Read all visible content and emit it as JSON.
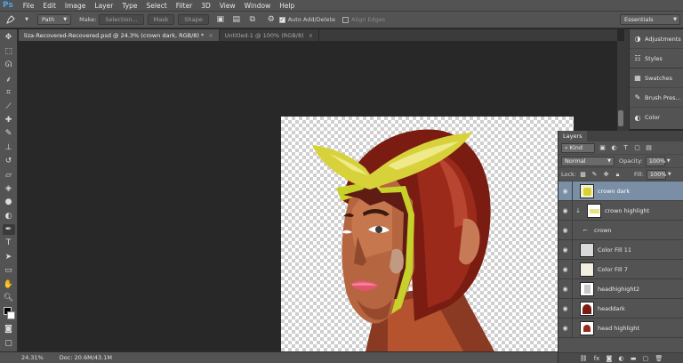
{
  "app": {
    "logo": "Ps",
    "menu": [
      "File",
      "Edit",
      "Image",
      "Layer",
      "Type",
      "Select",
      "Filter",
      "3D",
      "View",
      "Window",
      "Help"
    ]
  },
  "options": {
    "tool_icon": "pen-icon",
    "mode_value": "Path",
    "make_label": "Make:",
    "selection_btn": "Selection...",
    "mask_btn": "Mask",
    "shape_btn": "Shape",
    "auto_add_delete": "Auto Add/Delete",
    "align_edges": "Align Edges",
    "auto_add_checked": true,
    "align_edges_checked": false
  },
  "workspace": {
    "selected": "Essentials"
  },
  "tabs": [
    {
      "label": "liza-Recovered-Recovered.psd @ 24.3% (crown dark, RGB/8) *",
      "close": "×"
    },
    {
      "label": "Untitled-1 @ 100% (RGB/8)",
      "close": "×"
    }
  ],
  "status": {
    "zoom": "24.31%",
    "doc": "Doc: 20.6M/43.1M"
  },
  "right_panels": [
    {
      "label": "Adjustments",
      "icon": "adjustments-icon"
    },
    {
      "label": "Styles",
      "icon": "styles-icon"
    },
    {
      "label": "Swatches",
      "icon": "swatches-icon"
    },
    {
      "label": "Brush Pres...",
      "icon": "brush-presets-icon"
    },
    {
      "label": "Color",
      "icon": "color-icon"
    }
  ],
  "layers": {
    "tab_label": "Layers",
    "filter_kind": "Kind",
    "blend_mode": "Normal",
    "opacity_label": "Opacity:",
    "opacity_value": "100%",
    "lock_label": "Lock:",
    "fill_label": "Fill:",
    "fill_value": "100%",
    "items": [
      {
        "name": "crown dark",
        "selected": true
      },
      {
        "name": "crown highlight",
        "selected": false
      },
      {
        "name": "crown",
        "selected": false
      },
      {
        "name": "Color Fill 11",
        "selected": false
      },
      {
        "name": "Color Fill 7",
        "selected": false
      },
      {
        "name": "headhighight2",
        "selected": false
      },
      {
        "name": "headdark",
        "selected": false
      },
      {
        "name": "head highlight",
        "selected": false
      }
    ]
  },
  "colors": {
    "panel": "#535353",
    "canvas_bg": "#282828",
    "selected_layer": "#7a8fa6",
    "accent": "#4aa7f0"
  }
}
